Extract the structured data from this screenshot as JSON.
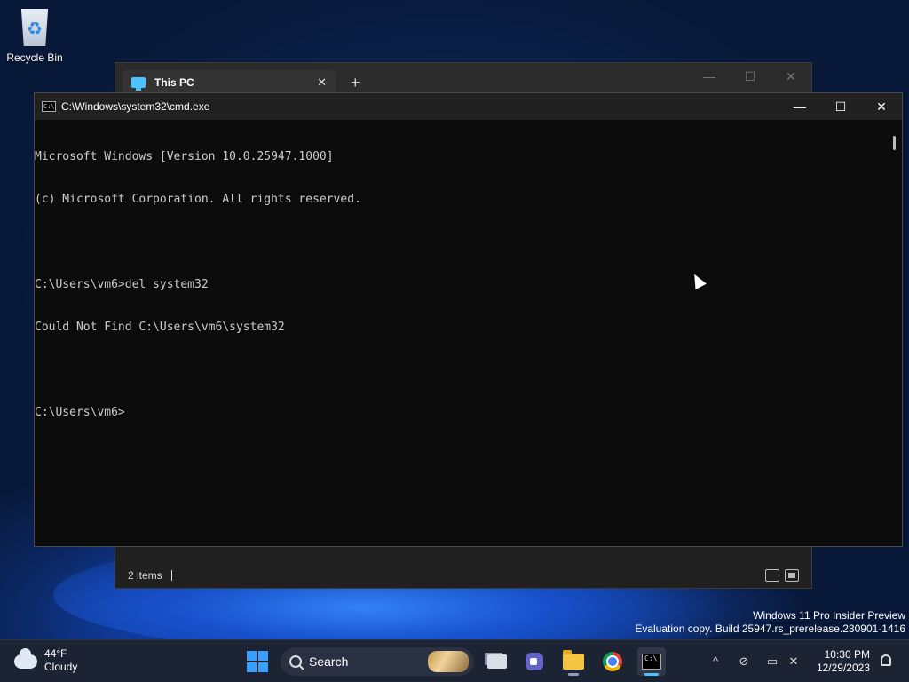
{
  "desktop": {
    "icons": [
      {
        "label": "Recycle Bin",
        "icon": "recycle-bin-icon"
      }
    ]
  },
  "explorer": {
    "tab_title": "This PC",
    "tab_close": "✕",
    "new_tab": "+",
    "minimize": "—",
    "maximize": "☐",
    "close": "✕",
    "status_items": "2 items"
  },
  "cmd": {
    "title": "C:\\Windows\\system32\\cmd.exe",
    "icon_text": "C:\\",
    "minimize": "—",
    "maximize": "☐",
    "close": "✕",
    "lines": [
      "Microsoft Windows [Version 10.0.25947.1000]",
      "(c) Microsoft Corporation. All rights reserved.",
      "",
      "C:\\Users\\vm6>del system32",
      "Could Not Find C:\\Users\\vm6\\system32",
      "",
      "C:\\Users\\vm6>"
    ]
  },
  "watermark": {
    "line1": "Windows 11 Pro Insider Preview",
    "line2": "Evaluation copy. Build 25947.rs_prerelease.230901-1416"
  },
  "taskbar": {
    "weather_temp": "44°F",
    "weather_desc": "Cloudy",
    "search_label": "Search",
    "apps": [
      {
        "name": "task-view",
        "active": false
      },
      {
        "name": "meet",
        "active": false
      },
      {
        "name": "file-explorer",
        "active": false
      },
      {
        "name": "chrome",
        "active": false
      },
      {
        "name": "terminal",
        "active": true
      }
    ],
    "terminal_icon_text": "C:\\_",
    "tray": {
      "chevron": "^"
    },
    "time": "10:30 PM",
    "date": "12/29/2023"
  },
  "colors": {
    "accent": "#4cc2ff",
    "console_bg": "#0c0c0c",
    "console_fg": "#cccccc",
    "taskbar_bg": "#1c2333"
  }
}
